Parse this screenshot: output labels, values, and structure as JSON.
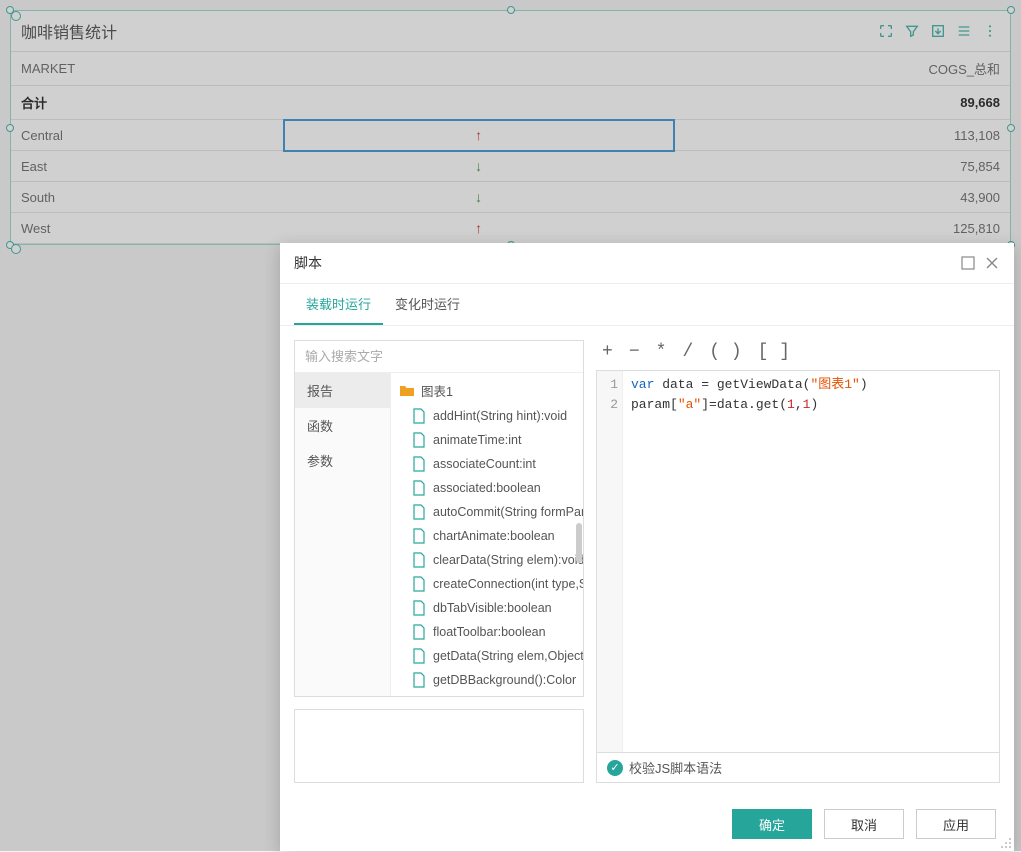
{
  "widget": {
    "title": "咖啡销售统计",
    "columns": {
      "market": "MARKET",
      "value": "COGS_总和"
    },
    "total": {
      "label": "合计",
      "value": "89,668"
    },
    "rows": [
      {
        "market": "Central",
        "arrow": "up",
        "value": "113,108",
        "selected": true
      },
      {
        "market": "East",
        "arrow": "down",
        "value": "75,854"
      },
      {
        "market": "South",
        "arrow": "down",
        "value": "43,900"
      },
      {
        "market": "West",
        "arrow": "up",
        "value": "125,810"
      }
    ]
  },
  "dialog": {
    "title": "脚本",
    "tabs": {
      "load": "装载时运行",
      "change": "变化时运行"
    },
    "search_placeholder": "输入搜索文字",
    "categories": {
      "report": "报告",
      "function": "函数",
      "param": "参数"
    },
    "tree": {
      "folder": "图表1",
      "items": [
        "addHint(String hint):void",
        "animateTime:int",
        "associateCount:int",
        "associated:boolean",
        "autoCommit(String formParmeter):void",
        "chartAnimate:boolean",
        "clearData(String elem):void",
        "createConnection(int type,String name):Connection",
        "dbTabVisible:boolean",
        "floatToolbar:boolean",
        "getData(String elem,Object otype):Object",
        "getDBBackground():Color"
      ]
    },
    "toolbar": {
      "plus": "+",
      "minus": "−",
      "star": "*",
      "slash": "/",
      "paren": "( )",
      "bracket": "[ ]"
    },
    "code": {
      "line1_num": "1",
      "line2_num": "2",
      "kw_var": "var",
      "id_data": " data = getViewData(",
      "str_chart": "\"图表1\"",
      "paren_close": ")",
      "l2_a": "param[",
      "l2_str": "\"a\"",
      "l2_b": "]=data.get(",
      "l2_n1": "1",
      "l2_c": ",",
      "l2_n2": "1",
      "l2_d": ")"
    },
    "validate": "校验JS脚本语法",
    "buttons": {
      "ok": "确定",
      "cancel": "取消",
      "apply": "应用"
    }
  }
}
